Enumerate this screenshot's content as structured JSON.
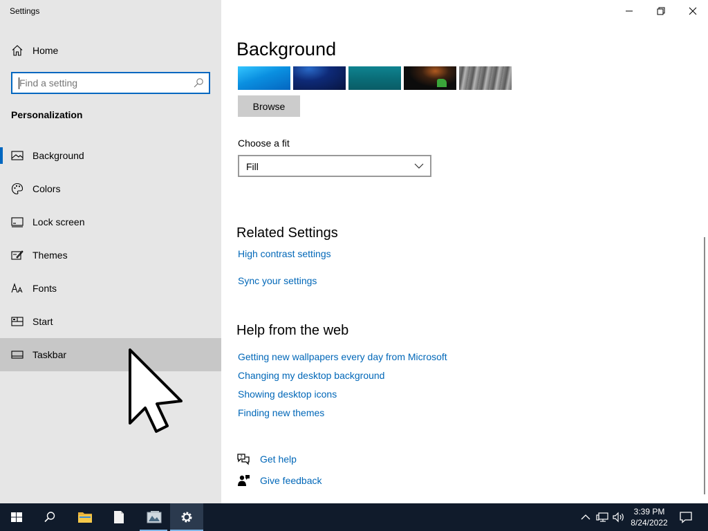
{
  "window": {
    "title": "Settings"
  },
  "sidebar": {
    "home_label": "Home",
    "search": {
      "placeholder": "Find a setting",
      "value": ""
    },
    "section_title": "Personalization",
    "items": [
      {
        "label": "Background",
        "icon": "picture-icon",
        "selected": true
      },
      {
        "label": "Colors",
        "icon": "palette-icon"
      },
      {
        "label": "Lock screen",
        "icon": "lock-screen-icon"
      },
      {
        "label": "Themes",
        "icon": "themes-icon"
      },
      {
        "label": "Fonts",
        "icon": "fonts-icon"
      },
      {
        "label": "Start",
        "icon": "start-icon"
      },
      {
        "label": "Taskbar",
        "icon": "taskbar-icon",
        "hovered": true
      }
    ]
  },
  "main": {
    "title": "Background",
    "browse_label": "Browse",
    "fit": {
      "label": "Choose a fit",
      "value": "Fill"
    },
    "related": {
      "title": "Related Settings",
      "links": [
        "High contrast settings",
        "Sync your settings"
      ]
    },
    "help_web": {
      "title": "Help from the web",
      "links": [
        "Getting new wallpapers every day from Microsoft",
        "Changing my desktop background",
        "Showing desktop icons",
        "Finding new themes"
      ]
    },
    "get_help": "Get help",
    "give_feedback": "Give feedback"
  },
  "taskbar": {
    "clock": {
      "time": "3:39 PM",
      "date": "8/24/2022"
    }
  },
  "colors": {
    "accent": "#0067c0",
    "link": "#0067b8",
    "sidebar_bg": "#e6e6e6",
    "taskbar_bg": "#101b2b"
  }
}
